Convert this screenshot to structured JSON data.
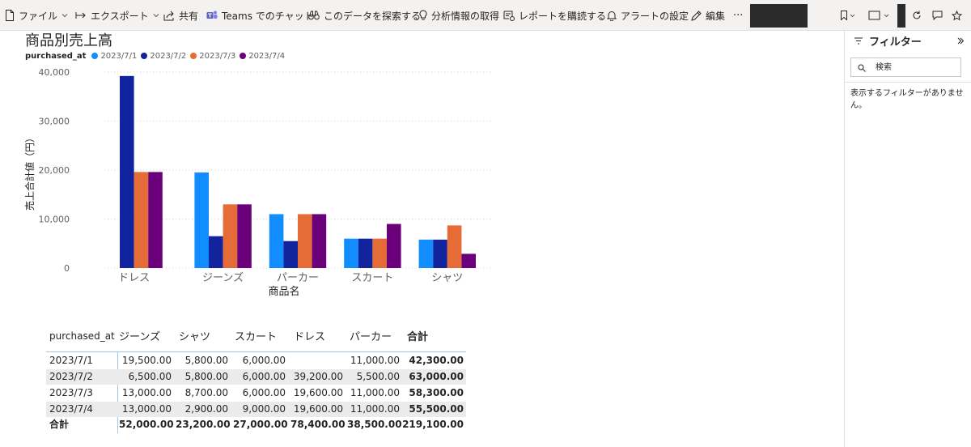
{
  "toolbar": {
    "file": "ファイル",
    "export": "エクスポート",
    "share": "共有",
    "teams_chat": "Teams でのチャット",
    "explore": "このデータを探索する",
    "insights": "分析情報の取得",
    "subscribe": "レポートを購読する",
    "alert": "アラートの設定",
    "edit": "編集",
    "more": "···"
  },
  "visual": {
    "title": "商品別売上高"
  },
  "chart_data": {
    "type": "bar",
    "title": "商品別売上高",
    "xlabel": "商品名",
    "ylabel": "売上合計値（円）",
    "legend_title": "purchased_at",
    "legend_position": "top-left",
    "grid": true,
    "ylim": [
      0,
      40000
    ],
    "yticks": [
      "0",
      "10,000",
      "20,000",
      "30,000",
      "40,000"
    ],
    "categories": [
      "ドレス",
      "ジーンズ",
      "パーカー",
      "スカート",
      "シャツ"
    ],
    "series": [
      {
        "name": "2023/7/1",
        "color": "#118dff",
        "values": [
          0,
          19500,
          11000,
          6000,
          5800
        ]
      },
      {
        "name": "2023/7/2",
        "color": "#12239e",
        "values": [
          39200,
          6500,
          5500,
          6000,
          5800
        ]
      },
      {
        "name": "2023/7/3",
        "color": "#e66c37",
        "values": [
          19600,
          13000,
          11000,
          6000,
          8700
        ]
      },
      {
        "name": "2023/7/4",
        "color": "#6b007b",
        "values": [
          19600,
          13000,
          11000,
          9000,
          2900
        ]
      }
    ]
  },
  "matrix": {
    "corner": "purchased_at",
    "columns": [
      "ジーンズ",
      "シャツ",
      "スカート",
      "ドレス",
      "パーカー",
      "合計"
    ],
    "rows": [
      {
        "label": "2023/7/1",
        "cells": [
          "19,500.00",
          "5,800.00",
          "6,000.00",
          "",
          "11,000.00",
          "42,300.00"
        ]
      },
      {
        "label": "2023/7/2",
        "cells": [
          "6,500.00",
          "5,800.00",
          "6,000.00",
          "39,200.00",
          "5,500.00",
          "63,000.00"
        ]
      },
      {
        "label": "2023/7/3",
        "cells": [
          "13,000.00",
          "8,700.00",
          "6,000.00",
          "19,600.00",
          "11,000.00",
          "58,300.00"
        ]
      },
      {
        "label": "2023/7/4",
        "cells": [
          "13,000.00",
          "2,900.00",
          "9,000.00",
          "19,600.00",
          "11,000.00",
          "55,500.00"
        ]
      }
    ],
    "total": {
      "label": "合計",
      "cells": [
        "52,000.00",
        "23,200.00",
        "27,000.00",
        "78,400.00",
        "38,500.00",
        "219,100.00"
      ]
    }
  },
  "filter_pane": {
    "title": "フィルター",
    "search_placeholder": "検索",
    "empty_message": "表示するフィルターがありません。"
  }
}
